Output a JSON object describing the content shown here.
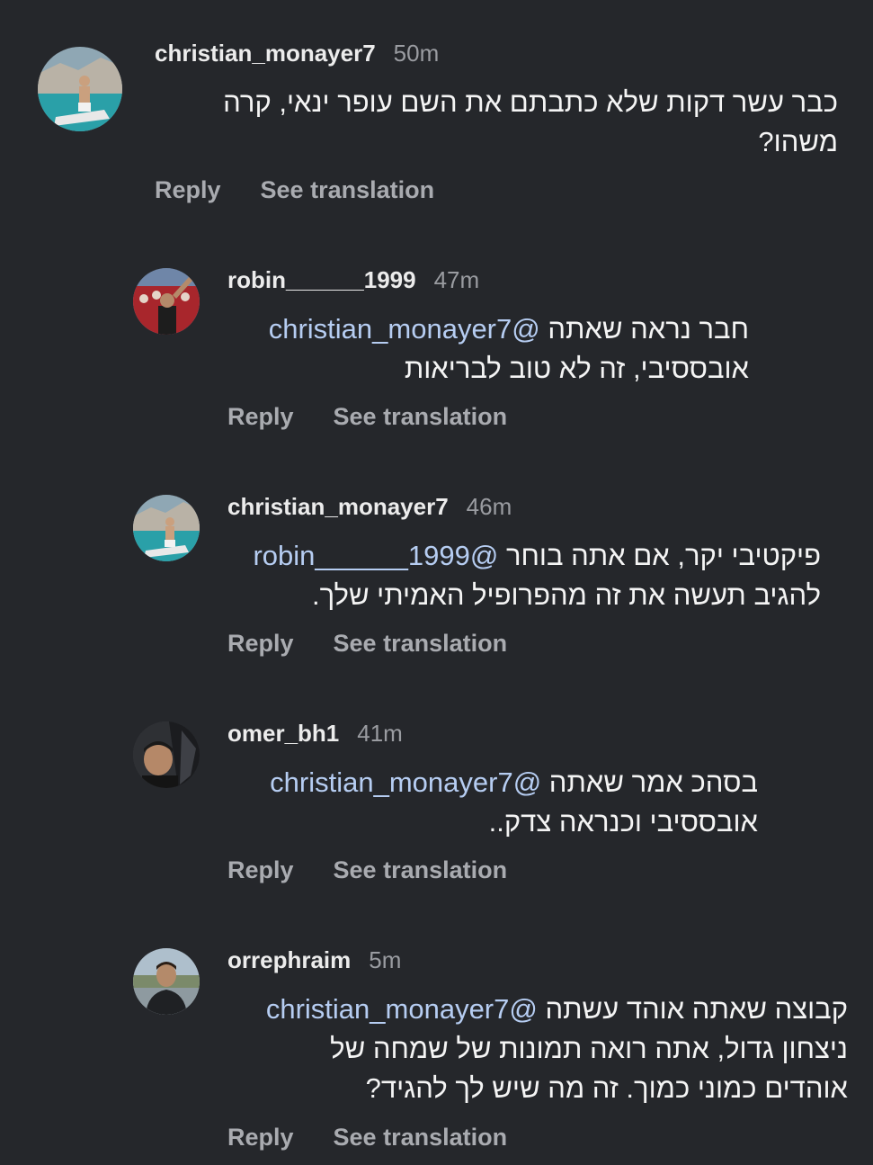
{
  "comments": [
    {
      "username": "christian_monayer7",
      "time": "50m",
      "mention": "",
      "text_line1": "כבר עשר דקות שלא כתבתם את השם עופר ינאי, קרה",
      "text_line2": "משהו?",
      "text_line3": "",
      "reply_label": "Reply",
      "translate_label": "See translation"
    },
    {
      "username": "robin______1999",
      "time": "47m",
      "mention": "@christian_monayer7",
      "text_line1": "חבר נראה שאתה",
      "text_line2": "אובססיבי, זה לא טוב לבריאות",
      "text_line3": "",
      "reply_label": "Reply",
      "translate_label": "See translation"
    },
    {
      "username": "christian_monayer7",
      "time": "46m",
      "mention": "@robin______1999",
      "text_line1": "פיקטיבי יקר, אם אתה בוחר",
      "text_line2": "להגיב תעשה את זה מהפרופיל האמיתי שלך.",
      "text_line3": "",
      "reply_label": "Reply",
      "translate_label": "See translation"
    },
    {
      "username": "omer_bh1",
      "time": "41m",
      "mention": "@christian_monayer7",
      "text_line1": "בסהכ אמר שאתה",
      "text_line2": "אובססיבי וכנראה צדק..",
      "text_line3": "",
      "reply_label": "Reply",
      "translate_label": "See translation"
    },
    {
      "username": "orrephraim",
      "time": "5m",
      "mention": "@christian_monayer7",
      "text_line1": "קבוצה שאתה אוהד עשתה",
      "text_line2": "ניצחון גדול, אתה רואה תמונות של שמחה של",
      "text_line3": "אוהדים כמוני כמוך. זה מה שיש לך להגיד?",
      "reply_label": "Reply",
      "translate_label": "See translation"
    }
  ],
  "colors": {
    "background": "#25272b",
    "mention": "#b6cdf2",
    "secondary_text": "#9a9ca1"
  }
}
